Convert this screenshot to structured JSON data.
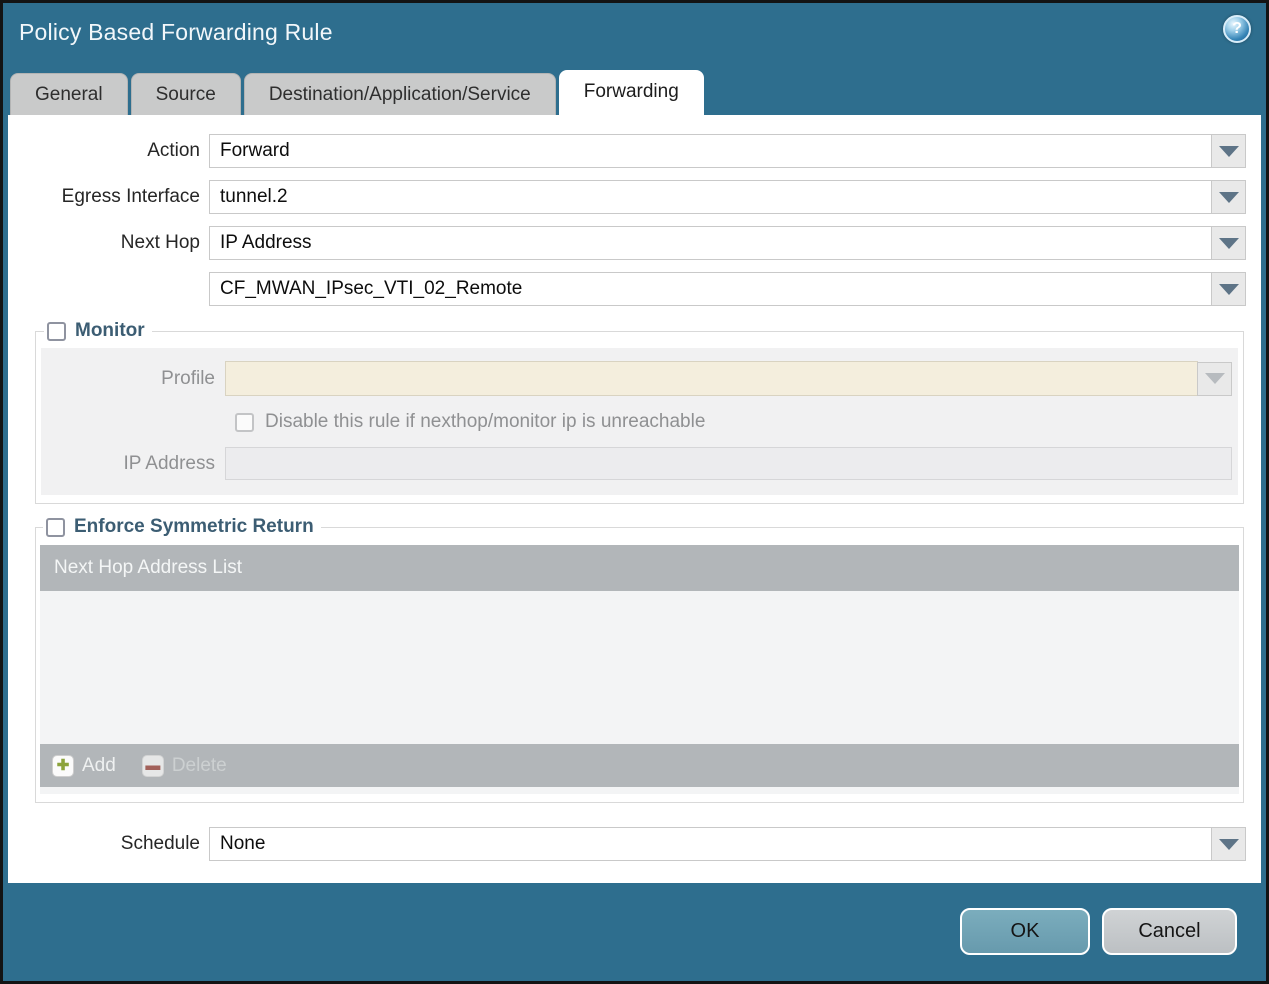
{
  "window": {
    "title": "Policy Based Forwarding Rule",
    "help_icon_glyph": "?"
  },
  "tabs": [
    {
      "label": "General",
      "active": false
    },
    {
      "label": "Source",
      "active": false
    },
    {
      "label": "Destination/Application/Service",
      "active": false
    },
    {
      "label": "Forwarding",
      "active": true
    }
  ],
  "form": {
    "action_label": "Action",
    "action_value": "Forward",
    "egress_label": "Egress Interface",
    "egress_value": "tunnel.2",
    "next_hop_label": "Next Hop",
    "next_hop_value": "IP Address",
    "next_hop_address_value": "CF_MWAN_IPsec_VTI_02_Remote",
    "schedule_label": "Schedule",
    "schedule_value": "None"
  },
  "monitor": {
    "legend": "Monitor",
    "checked": false,
    "profile_label": "Profile",
    "profile_value": "",
    "disable_checkbox_label": "Disable this rule if nexthop/monitor ip is unreachable",
    "disable_checked": false,
    "ip_address_label": "IP Address",
    "ip_address_value": ""
  },
  "symmetric_return": {
    "legend": "Enforce Symmetric Return",
    "checked": false,
    "table_header": "Next Hop Address List",
    "rows": [],
    "add_label": "Add",
    "add_icon_glyph": "✚",
    "delete_label": "Delete",
    "delete_icon_glyph": "▬"
  },
  "footer": {
    "ok_label": "OK",
    "cancel_label": "Cancel"
  },
  "colors": {
    "titlebar_teal": "#2e6e8e",
    "tab_inactive": "#c9caca",
    "disabled_beige_field": "#f4eedd",
    "disabled_gray_panel": "#f1f1f2",
    "table_gray": "#b2b6b9",
    "ok_button": "#6fa2b3",
    "cancel_button": "#c5c9cc",
    "legend_text": "#3c5d73"
  }
}
